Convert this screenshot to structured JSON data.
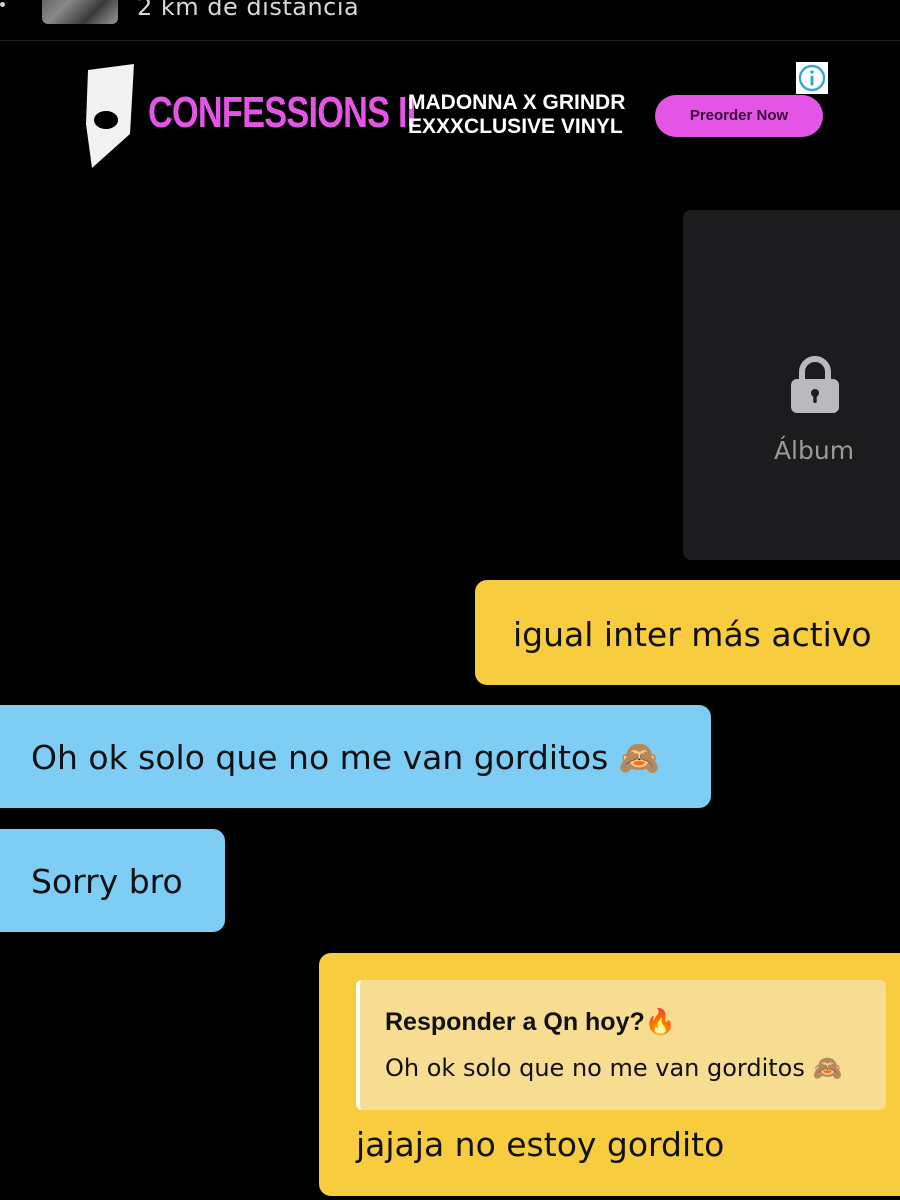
{
  "header": {
    "distance": "2 km de distancia"
  },
  "ad": {
    "title": "CONFESSIONS II",
    "line1": "MADONNA X GRINDR",
    "line2": "EXXXCLUSIVE VINYL",
    "cta": "Preorder Now",
    "info_icon": "info-icon",
    "brand_color": "#e455e6"
  },
  "album": {
    "label": "Álbum",
    "icon": "lock-icon"
  },
  "messages": [
    {
      "direction": "outgoing",
      "text": "igual inter más activo"
    },
    {
      "direction": "incoming",
      "text": "Oh ok solo que no me van gorditos 🙈"
    },
    {
      "direction": "incoming",
      "text": "Sorry bro"
    },
    {
      "direction": "outgoing",
      "reply_to": {
        "author": "Responder a Qn hoy?🔥",
        "text": "Oh ok solo que no me van gorditos 🙈"
      },
      "text": "jajaja no estoy gordito"
    }
  ],
  "colors": {
    "outgoing": "#f7cc3f",
    "incoming": "#7dcdf4",
    "reply_quote": "#f7dd92",
    "background": "#000000"
  }
}
